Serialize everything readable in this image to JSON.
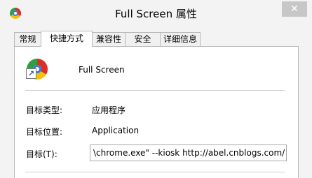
{
  "window": {
    "title": "Full Screen 属性",
    "close_glyph": "✕"
  },
  "tabs": [
    {
      "label": "常规"
    },
    {
      "label": "快捷方式",
      "active": true
    },
    {
      "label": "兼容性"
    },
    {
      "label": "安全"
    },
    {
      "label": "详细信息"
    }
  ],
  "shortcut": {
    "name": "Full Screen",
    "icon": "chrome-icon",
    "overlay_icon": "shortcut-arrow-icon"
  },
  "fields": {
    "target_type_label": "目标类型:",
    "target_type_value": "应用程序",
    "target_location_label": "目标位置:",
    "target_location_value": "Application",
    "target_label": "目标(T):",
    "target_value": "\\chrome.exe\" --kiosk http://abel.cnblogs.com/"
  }
}
